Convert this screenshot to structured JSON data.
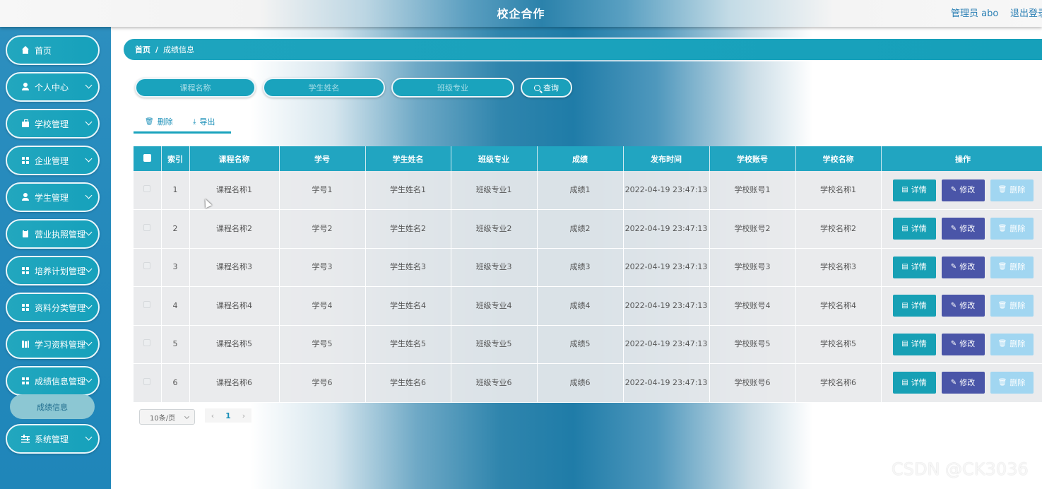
{
  "header": {
    "title": "校企合作",
    "admin": "管理员 abo",
    "logout": "退出登录"
  },
  "sidebar": {
    "items": [
      {
        "label": "首页",
        "icon": "home-icon",
        "has_submenu": false
      },
      {
        "label": "个人中心",
        "icon": "user-icon",
        "has_submenu": true
      },
      {
        "label": "学校管理",
        "icon": "briefcase-icon",
        "has_submenu": true
      },
      {
        "label": "企业管理",
        "icon": "grid-icon",
        "has_submenu": true
      },
      {
        "label": "学生管理",
        "icon": "user-icon",
        "has_submenu": true
      },
      {
        "label": "营业执照管理",
        "icon": "clipboard-icon",
        "has_submenu": true
      },
      {
        "label": "培养计划管理",
        "icon": "grid-icon",
        "has_submenu": true
      },
      {
        "label": "资料分类管理",
        "icon": "grid-icon",
        "has_submenu": true
      },
      {
        "label": "学习资料管理",
        "icon": "book-icon",
        "has_submenu": true
      },
      {
        "label": "成绩信息管理",
        "icon": "grid-icon",
        "has_submenu": true
      },
      {
        "label": "系统管理",
        "icon": "sliders-icon",
        "has_submenu": true
      }
    ],
    "active_sub": "成绩信息"
  },
  "breadcrumb": {
    "home": "首页",
    "separator": "/",
    "current": "成绩信息"
  },
  "search": {
    "course_placeholder": "课程名称",
    "student_placeholder": "学生姓名",
    "class_placeholder": "班级专业",
    "button_label": "查询"
  },
  "toolbar": {
    "delete_label": "删除",
    "export_label": "导出"
  },
  "table": {
    "headers": [
      "索引",
      "课程名称",
      "学号",
      "学生姓名",
      "班级专业",
      "成绩",
      "发布时间",
      "学校账号",
      "学校名称",
      "操作"
    ],
    "rows": [
      [
        "1",
        "课程名称1",
        "学号1",
        "学生姓名1",
        "班级专业1",
        "成绩1",
        "2022-04-19 23:47:13",
        "学校账号1",
        "学校名称1"
      ],
      [
        "2",
        "课程名称2",
        "学号2",
        "学生姓名2",
        "班级专业2",
        "成绩2",
        "2022-04-19 23:47:13",
        "学校账号2",
        "学校名称2"
      ],
      [
        "3",
        "课程名称3",
        "学号3",
        "学生姓名3",
        "班级专业3",
        "成绩3",
        "2022-04-19 23:47:13",
        "学校账号3",
        "学校名称3"
      ],
      [
        "4",
        "课程名称4",
        "学号4",
        "学生姓名4",
        "班级专业4",
        "成绩4",
        "2022-04-19 23:47:13",
        "学校账号4",
        "学校名称4"
      ],
      [
        "5",
        "课程名称5",
        "学号5",
        "学生姓名5",
        "班级专业5",
        "成绩5",
        "2022-04-19 23:47:13",
        "学校账号5",
        "学校名称5"
      ],
      [
        "6",
        "课程名称6",
        "学号6",
        "学生姓名6",
        "班级专业6",
        "成绩6",
        "2022-04-19 23:47:13",
        "学校账号6",
        "学校名称6"
      ]
    ],
    "actions": {
      "detail": "详情",
      "edit": "修改",
      "delete": "删除"
    }
  },
  "pagination": {
    "page_size": "10条/页",
    "current_page": "1",
    "prev": "‹",
    "next": "›"
  },
  "watermark": "CSDN @CK3036",
  "colors": {
    "accent": "#1aa3bd",
    "edit": "#4a55a8",
    "delete": "#a1d6f1",
    "sidebar": "#2489bc"
  }
}
